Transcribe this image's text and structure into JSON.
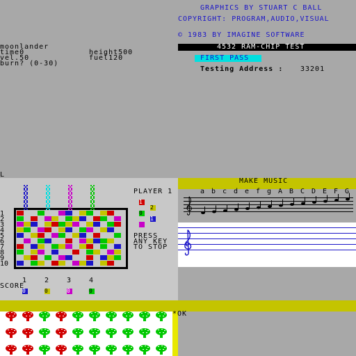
{
  "credits": {
    "line1": "GRAPHICS BY STUART C BALL",
    "line2": "COPYRIGHT: PROGRAM,AUDIO,VISUAL",
    "line3": "© 1983 BY IMAGINE SOFTWARE"
  },
  "ramtest": {
    "title": "4532 RAM-CHIP TEST",
    "pass": "FIRST PASS",
    "address_label": "Testing Address :",
    "address_value": "33201"
  },
  "lander": {
    "title": "moonlander",
    "time": "time0",
    "height": "height500",
    "vel": "vel.50",
    "fuel": "fuel120",
    "prompt": "burn? (0-30)"
  },
  "cursor_l": "L",
  "game": {
    "player_label": "PLAYER 1",
    "row_numbers": [
      "1",
      "2",
      "3",
      "4",
      "5",
      "6",
      "7",
      "8",
      "9",
      "10"
    ],
    "press_text": [
      "PRESS",
      "ANY KEY",
      "TO STOP"
    ],
    "score_label": "SCORE",
    "columns": [
      "1",
      "2",
      "3",
      "4"
    ],
    "scores": [
      "0",
      "0",
      "0",
      "0"
    ],
    "key_values": [
      "1",
      "2",
      "0",
      "1"
    ]
  },
  "music": {
    "title": "MAKE MUSIC",
    "notes": [
      "a",
      "b",
      "c",
      "d",
      "e",
      "f",
      "g",
      "A",
      "B",
      "C",
      "D",
      "E",
      "F",
      "G"
    ]
  },
  "bottom": {
    "ok_text": "*OK"
  },
  "colors": {
    "blue_text": "#1a14c8",
    "yellow_band": "#c4c400",
    "cyan_highlight": "#00e0e0",
    "panel_grey": "#c8c8c8",
    "red": "#d00000",
    "green": "#00c800",
    "magenta": "#c800c8",
    "music_blue": "#1a14c8"
  }
}
